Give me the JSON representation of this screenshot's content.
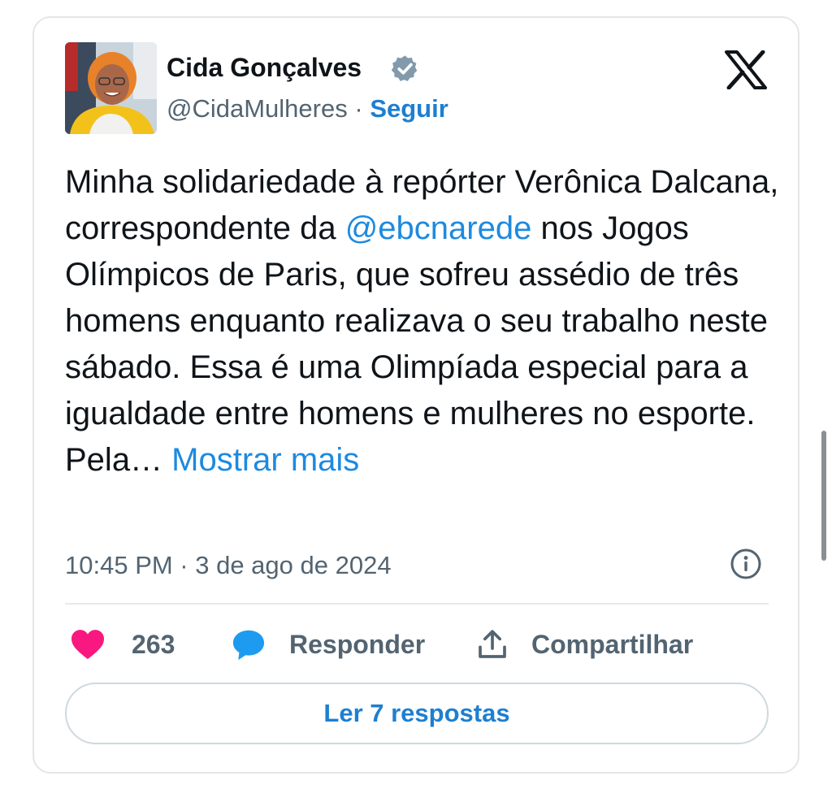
{
  "tweet": {
    "author_name": "Cida Gonçalves",
    "handle": "@CidaMulheres",
    "separator": "·",
    "follow_label": "Seguir",
    "text_part1": "Minha solidariedade à repórter Verônica Dalcana, correspondente da ",
    "mention": "@ebcnarede",
    "text_part2": " nos Jogos Olímpicos de Paris, que sofreu assédio de três homens enquanto realizava o seu trabalho neste sábado. Essa é uma Olimpíada especial para a igualdade entre homens e mulheres no esporte. Pela… ",
    "show_more_label": "Mostrar mais",
    "timestamp": "10:45 PM · 3 de ago de 2024"
  },
  "actions": {
    "likes_count": "263",
    "reply_label": "Responder",
    "share_label": "Compartilhar"
  },
  "read_replies_label": "Ler 7 respostas",
  "icons": {
    "verified": "verified-badge-icon",
    "brand": "x-logo-icon",
    "info": "info-icon",
    "like": "heart-icon",
    "reply": "speech-bubble-icon",
    "share": "share-icon"
  },
  "colors": {
    "link": "#1d8ae0",
    "like": "#f91880",
    "reply": "#1d9bf0",
    "muted": "#536471",
    "verified": "#829aab"
  }
}
